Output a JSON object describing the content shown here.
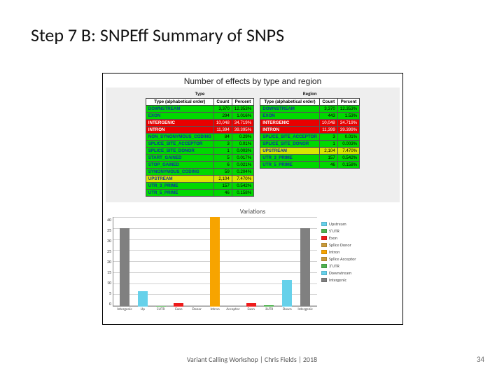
{
  "slide": {
    "title": "Step 7 B: SNPEff Summary of SNPS",
    "footer": "Variant Calling Workshop | Chris Fields | 2018",
    "page_number": "34"
  },
  "panel": {
    "title": "Number of effects by type and region",
    "columns": [
      "Type",
      "Region"
    ],
    "headers": [
      "Type (alphabetical order)",
      "Count",
      "Percent"
    ],
    "type_rows": [
      {
        "label": "DOWNSTREAM",
        "count": "3,370",
        "pct": "12.353%",
        "sev": "low"
      },
      {
        "label": "EXON",
        "count": "294",
        "pct": "1.016%",
        "sev": "low"
      },
      {
        "label": "INTERGENIC",
        "count": "10,048",
        "pct": "34.719%",
        "sev": "high"
      },
      {
        "label": "INTRON",
        "count": "11,394",
        "pct": "39.395%",
        "sev": "high"
      },
      {
        "label": "NON_SYNONYMOUS_CODING",
        "count": "84",
        "pct": "0.29%",
        "sev": "low"
      },
      {
        "label": "SPLICE_SITE_ACCEPTOR",
        "count": "3",
        "pct": "0.01%",
        "sev": "low"
      },
      {
        "label": "SPLICE_SITE_DONOR",
        "count": "1",
        "pct": "0.003%",
        "sev": "low"
      },
      {
        "label": "START_GAINED",
        "count": "5",
        "pct": "0.017%",
        "sev": "low"
      },
      {
        "label": "STOP_GAINED",
        "count": "6",
        "pct": "0.021%",
        "sev": "low"
      },
      {
        "label": "SYNONYMOUS_CODING",
        "count": "59",
        "pct": "0.204%",
        "sev": "low"
      },
      {
        "label": "UPSTREAM",
        "count": "2,104",
        "pct": "7.470%",
        "sev": "mid"
      },
      {
        "label": "UTR_3_PRIME",
        "count": "157",
        "pct": "0.542%",
        "sev": "low"
      },
      {
        "label": "UTR_5_PRIME",
        "count": "46",
        "pct": "0.158%",
        "sev": "low"
      }
    ],
    "region_rows": [
      {
        "label": "DOWNSTREAM",
        "count": "3,370",
        "pct": "12.353%",
        "sev": "low"
      },
      {
        "label": "EXON",
        "count": "443",
        "pct": "1.53%",
        "sev": "low"
      },
      {
        "label": "INTERGENIC",
        "count": "10,048",
        "pct": "34.719%",
        "sev": "high"
      },
      {
        "label": "INTRON",
        "count": "11,399",
        "pct": "39.399%",
        "sev": "high"
      },
      {
        "label": "SPLICE_SITE_ACCEPTOR",
        "count": "3",
        "pct": "0.01%",
        "sev": "low"
      },
      {
        "label": "SPLICE_SITE_DONOR",
        "count": "1",
        "pct": "0.003%",
        "sev": "low"
      },
      {
        "label": "UPSTREAM",
        "count": "2,104",
        "pct": "7.470%",
        "sev": "mid"
      },
      {
        "label": "UTR_3_PRIME",
        "count": "157",
        "pct": "0.542%",
        "sev": "low"
      },
      {
        "label": "UTR_5_PRIME",
        "count": "46",
        "pct": "0.158%",
        "sev": "low"
      }
    ]
  },
  "chart_data": {
    "type": "bar",
    "title": "Variations",
    "ylabel": "%",
    "ylim": [
      0,
      40
    ],
    "yticks": [
      40,
      35,
      30,
      25,
      20,
      15,
      10,
      5,
      0
    ],
    "categories": [
      "Intergenic",
      "Up",
      "5UTR",
      "Exon",
      "Donor",
      "Intron",
      "Acceptor",
      "Exon",
      "3UTR",
      "Down",
      "Intergenic"
    ],
    "values": [
      35,
      7,
      0.2,
      1.5,
      0.01,
      40,
      0.01,
      1.5,
      0.5,
      12,
      35
    ],
    "colors": [
      "#808080",
      "#66d1ea",
      "#4fb24f",
      "#ee1c1c",
      "#c99a3a",
      "#f7a400",
      "#c99a3a",
      "#ee1c1c",
      "#4fb24f",
      "#66d1ea",
      "#808080"
    ],
    "legend": [
      {
        "label": "Upstream",
        "color": "#66d1ea"
      },
      {
        "label": "5'UTR",
        "color": "#4fb24f"
      },
      {
        "label": "Exon",
        "color": "#ee1c1c"
      },
      {
        "label": "Splice Donor",
        "color": "#c99a3a"
      },
      {
        "label": "Intron",
        "color": "#f7a400"
      },
      {
        "label": "Splice Acceptor",
        "color": "#c99a3a"
      },
      {
        "label": "3'UTR",
        "color": "#4fb24f"
      },
      {
        "label": "Downstream",
        "color": "#66d1ea"
      },
      {
        "label": "Intergenic",
        "color": "#808080"
      }
    ]
  }
}
